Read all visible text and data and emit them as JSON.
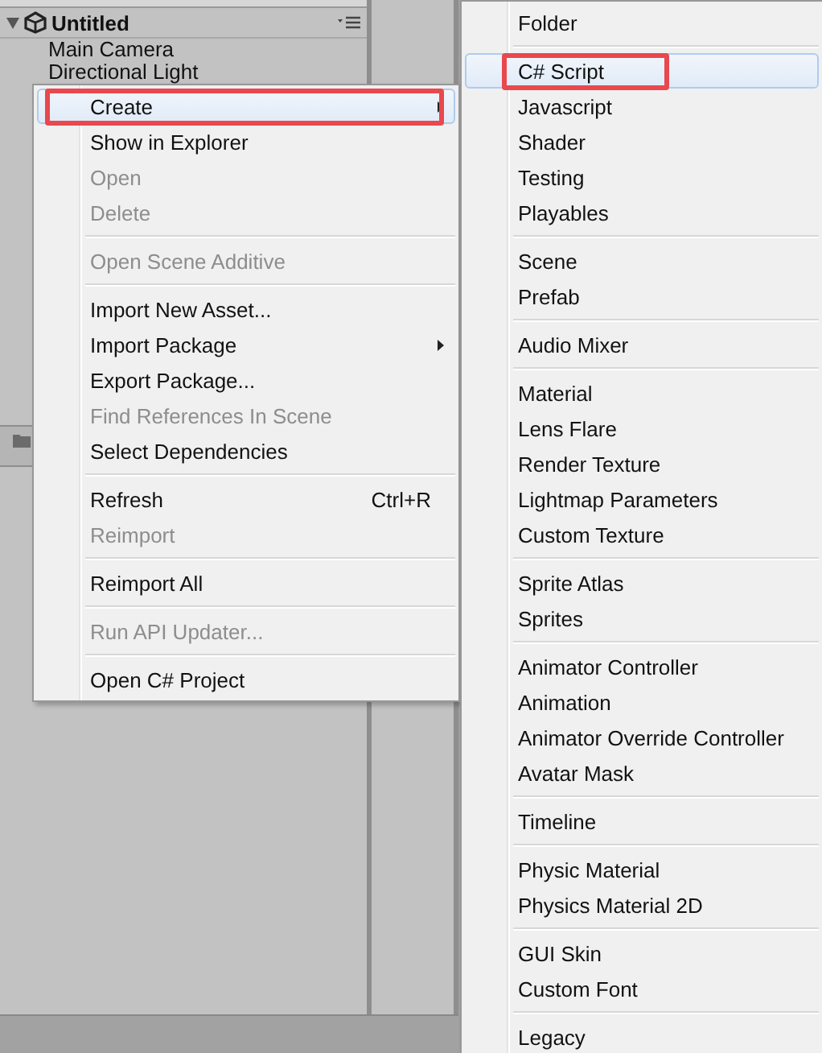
{
  "hierarchy": {
    "scene": "Untitled",
    "items": [
      "Main Camera",
      "Directional Light"
    ]
  },
  "context_menu": [
    [
      {
        "label": "Create",
        "selected": true,
        "disabled": false,
        "submenu": true
      },
      {
        "label": "Show in Explorer",
        "selected": false,
        "disabled": false
      },
      {
        "label": "Open",
        "selected": false,
        "disabled": true
      },
      {
        "label": "Delete",
        "selected": false,
        "disabled": true
      }
    ],
    [
      {
        "label": "Open Scene Additive",
        "selected": false,
        "disabled": true
      }
    ],
    [
      {
        "label": "Import New Asset...",
        "selected": false,
        "disabled": false
      },
      {
        "label": "Import Package",
        "selected": false,
        "disabled": false,
        "submenu": true
      },
      {
        "label": "Export Package...",
        "selected": false,
        "disabled": false
      },
      {
        "label": "Find References In Scene",
        "selected": false,
        "disabled": true
      },
      {
        "label": "Select Dependencies",
        "selected": false,
        "disabled": false
      }
    ],
    [
      {
        "label": "Refresh",
        "selected": false,
        "disabled": false,
        "shortcut": "Ctrl+R"
      },
      {
        "label": "Reimport",
        "selected": false,
        "disabled": true
      }
    ],
    [
      {
        "label": "Reimport All",
        "selected": false,
        "disabled": false
      }
    ],
    [
      {
        "label": "Run API Updater...",
        "selected": false,
        "disabled": true
      }
    ],
    [
      {
        "label": "Open C# Project",
        "selected": false,
        "disabled": false
      }
    ]
  ],
  "create_submenu": [
    [
      {
        "label": "Folder",
        "selected": false
      }
    ],
    [
      {
        "label": "C# Script",
        "selected": true
      },
      {
        "label": "Javascript",
        "selected": false
      },
      {
        "label": "Shader",
        "selected": false
      },
      {
        "label": "Testing",
        "selected": false
      },
      {
        "label": "Playables",
        "selected": false
      }
    ],
    [
      {
        "label": "Scene",
        "selected": false
      },
      {
        "label": "Prefab",
        "selected": false
      }
    ],
    [
      {
        "label": "Audio Mixer",
        "selected": false
      }
    ],
    [
      {
        "label": "Material",
        "selected": false
      },
      {
        "label": "Lens Flare",
        "selected": false
      },
      {
        "label": "Render Texture",
        "selected": false
      },
      {
        "label": "Lightmap Parameters",
        "selected": false
      },
      {
        "label": "Custom Texture",
        "selected": false
      }
    ],
    [
      {
        "label": "Sprite Atlas",
        "selected": false
      },
      {
        "label": "Sprites",
        "selected": false
      }
    ],
    [
      {
        "label": "Animator Controller",
        "selected": false
      },
      {
        "label": "Animation",
        "selected": false
      },
      {
        "label": "Animator Override Controller",
        "selected": false
      },
      {
        "label": "Avatar Mask",
        "selected": false
      }
    ],
    [
      {
        "label": "Timeline",
        "selected": false
      }
    ],
    [
      {
        "label": "Physic Material",
        "selected": false
      },
      {
        "label": "Physics Material 2D",
        "selected": false
      }
    ],
    [
      {
        "label": "GUI Skin",
        "selected": false
      },
      {
        "label": "Custom Font",
        "selected": false
      }
    ],
    [
      {
        "label": "Legacy",
        "selected": false
      }
    ]
  ]
}
